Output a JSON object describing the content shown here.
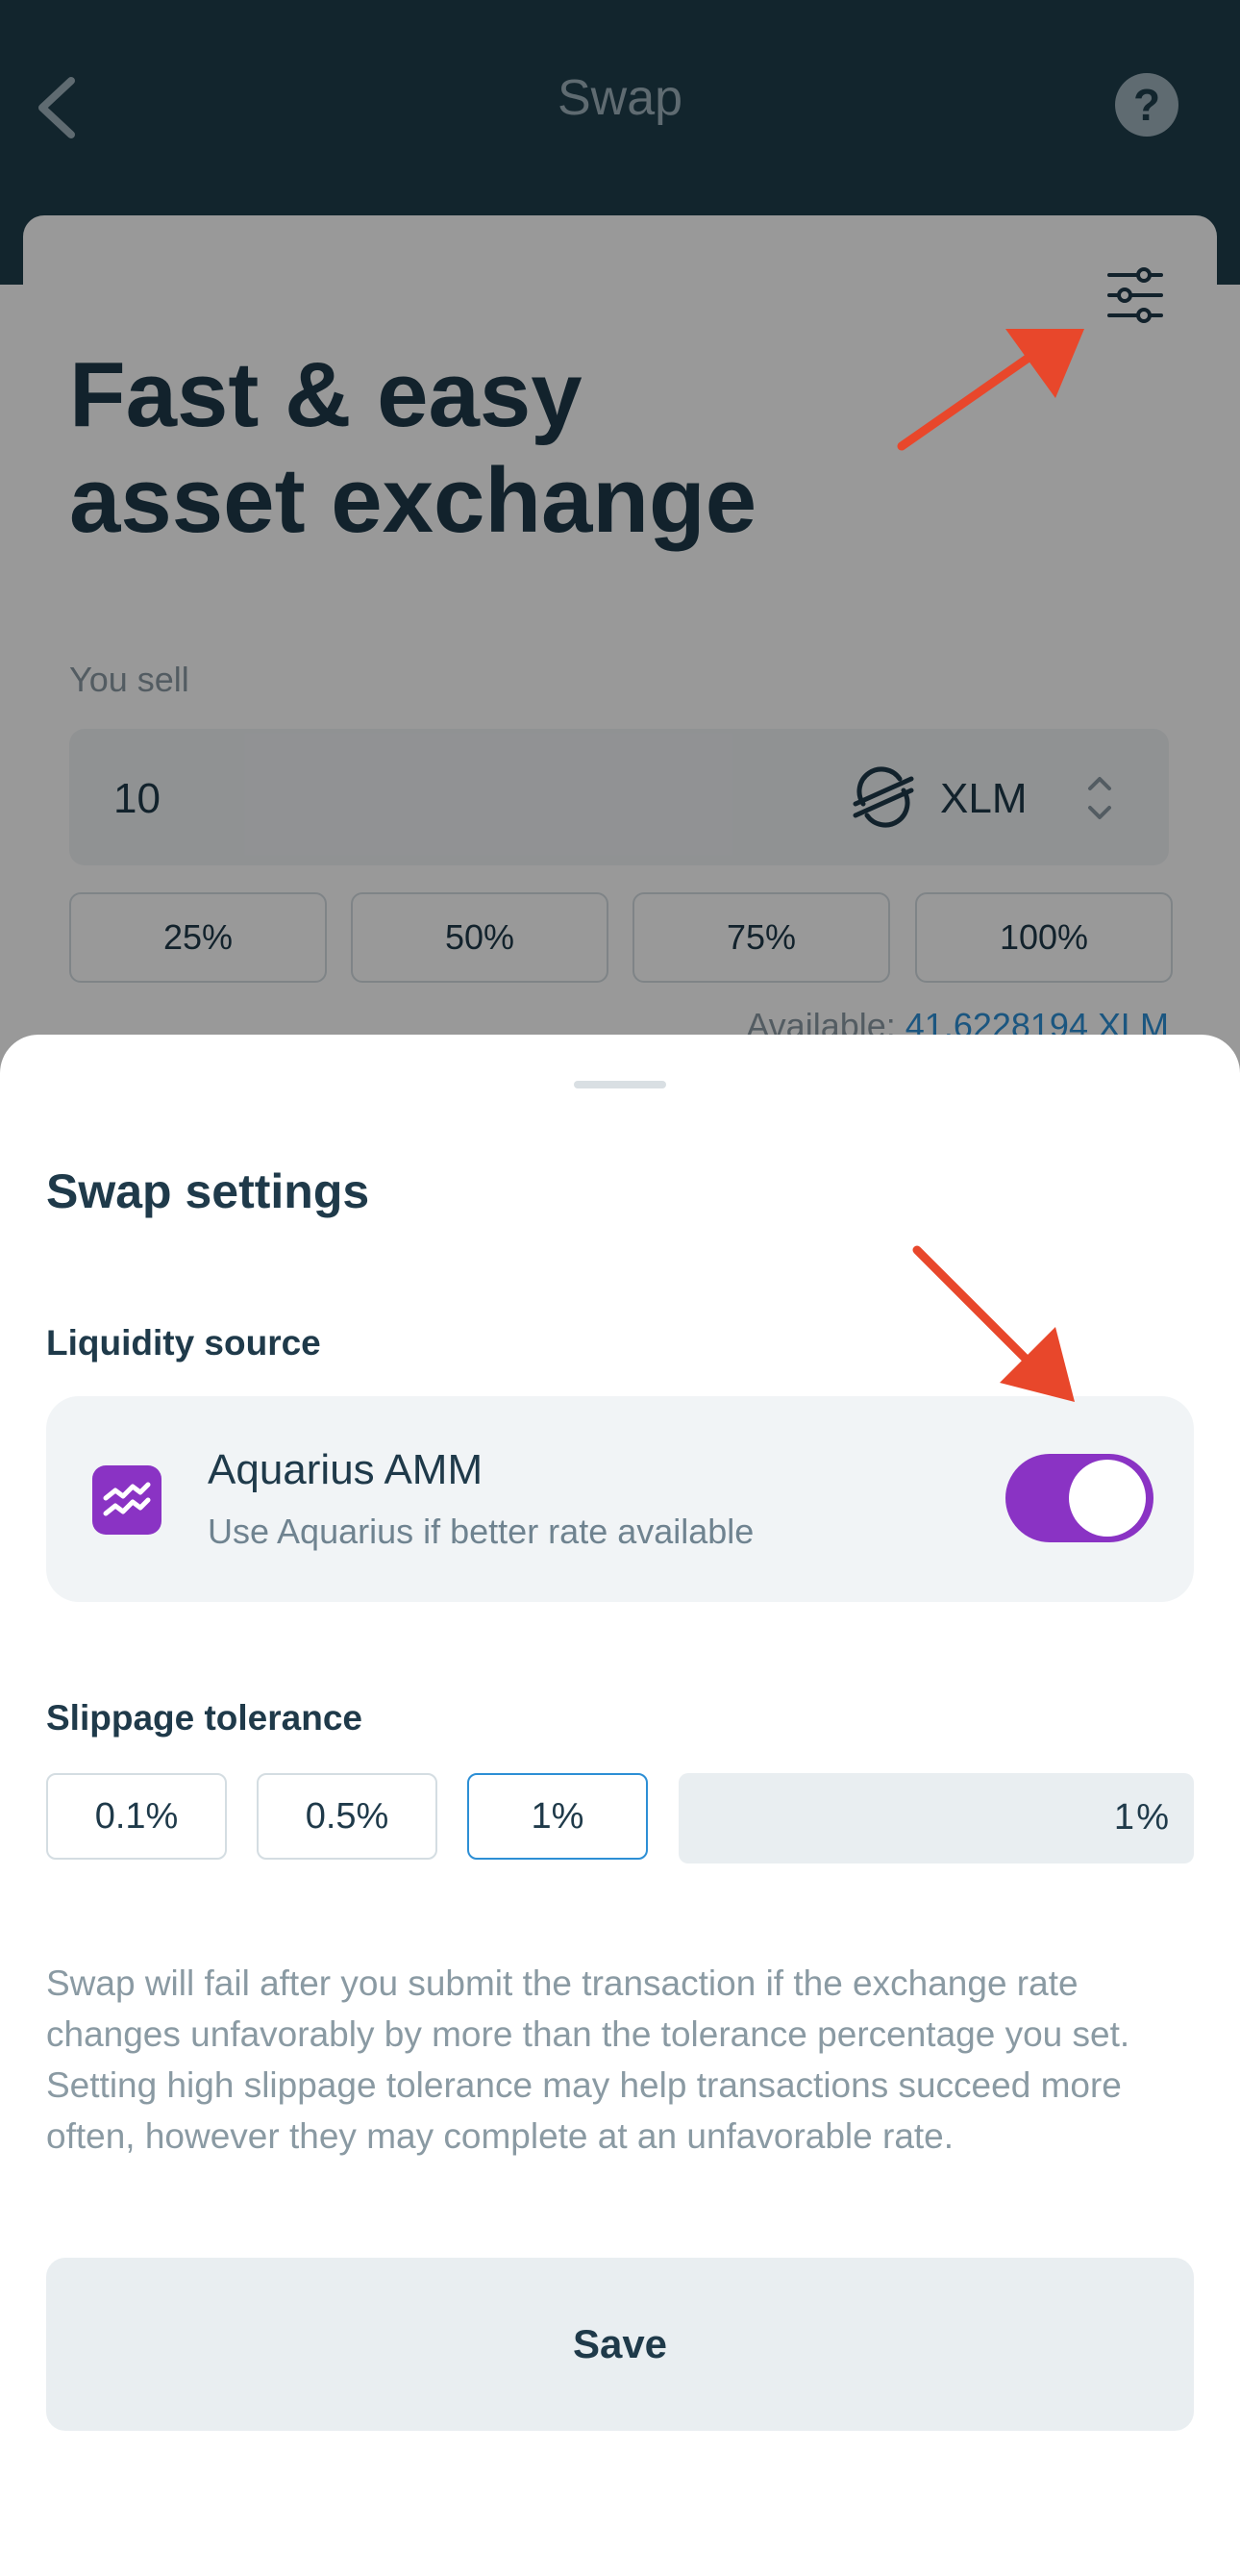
{
  "header": {
    "title": "Swap",
    "back_icon": "chevron-left-icon",
    "help_label": "?"
  },
  "hero": {
    "line1": "Fast & easy",
    "line2": "asset exchange"
  },
  "sell": {
    "label": "You sell",
    "amount": "10",
    "asset_code": "XLM",
    "asset_icon": "stellar-icon",
    "percent_buttons": [
      "25%",
      "50%",
      "75%",
      "100%"
    ],
    "available_label": "Available:",
    "available_value": "41.6228194 XLM"
  },
  "sheet": {
    "title": "Swap settings",
    "liquidity": {
      "label": "Liquidity source",
      "name": "Aquarius AMM",
      "description": "Use Aquarius if better rate available",
      "enabled": true
    },
    "slippage": {
      "label": "Slippage tolerance",
      "options": [
        "0.1%",
        "0.5%",
        "1%"
      ],
      "selected": "1%",
      "custom_value": "1",
      "custom_unit": "%"
    },
    "disclaimer": "Swap will fail after you submit the transaction if the exchange rate changes unfavorably by more than the tolerance percentage you set. Setting high slippage tolerance may help transactions succeed more often, however they may complete at an unfavorable rate.",
    "save_label": "Save"
  },
  "colors": {
    "header_bg": "#1e3e4b",
    "accent_purple": "#8a33c4",
    "link_blue": "#2d8fd5",
    "annotation_red": "#e8472b"
  }
}
